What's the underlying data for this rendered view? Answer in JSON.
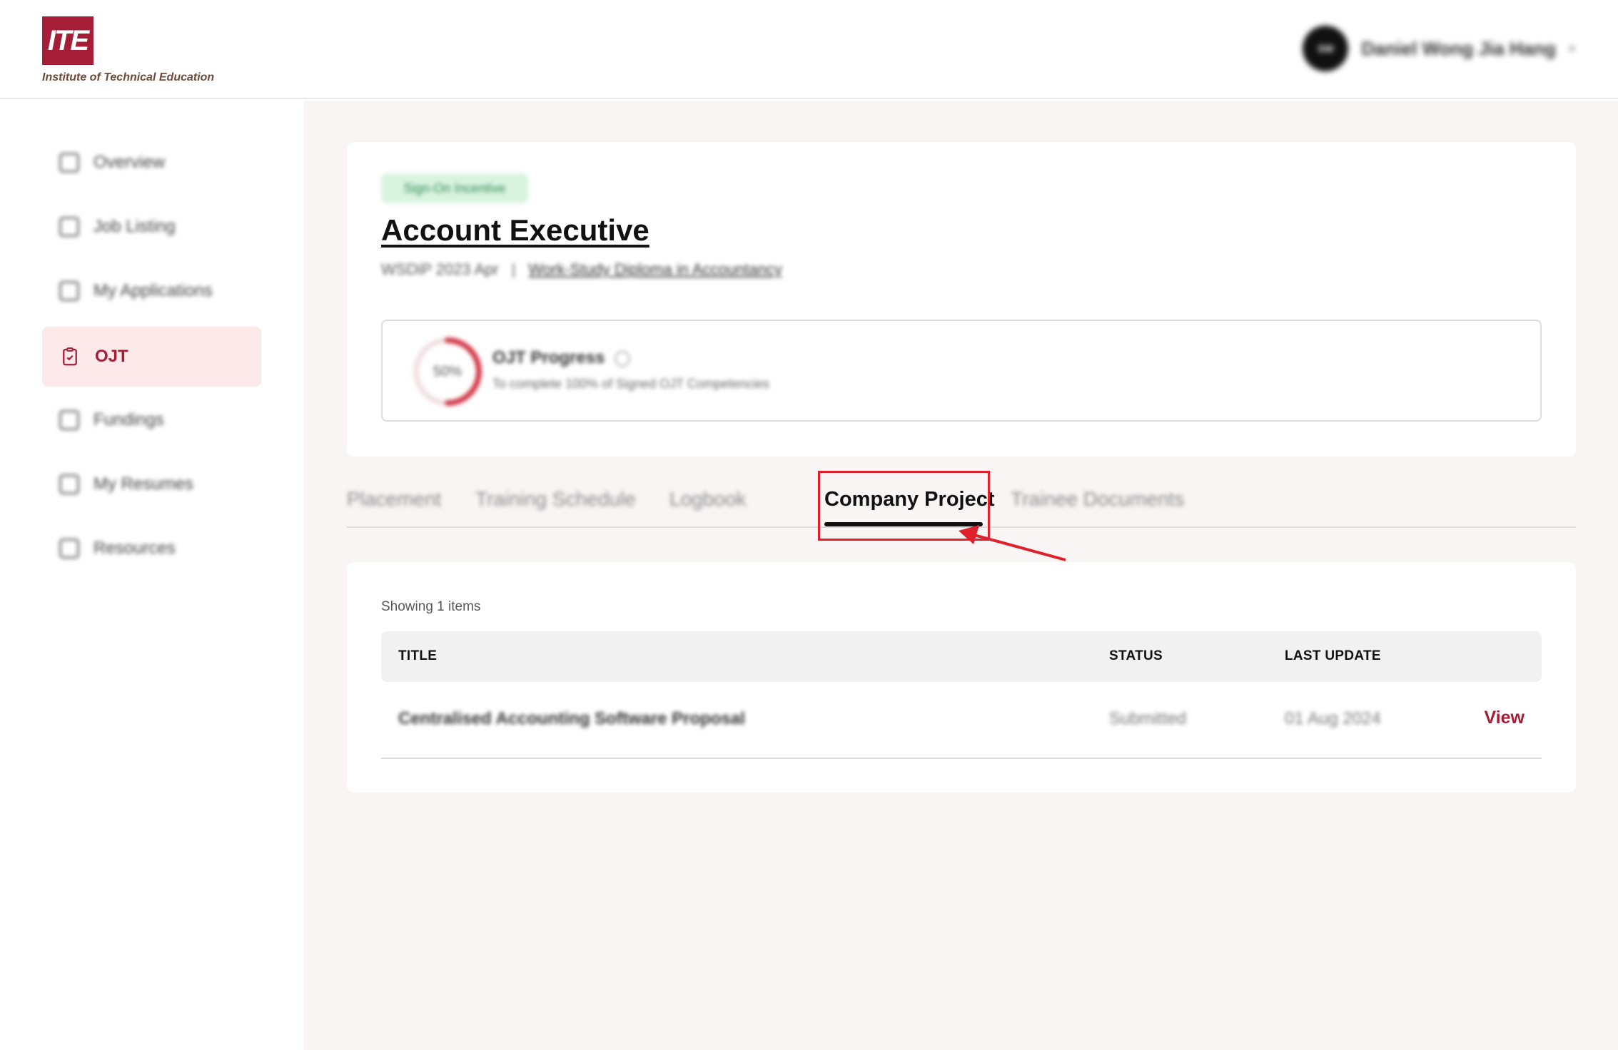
{
  "header": {
    "logo_mark": "ITE",
    "logo_text": "Institute of Technical Education",
    "user": {
      "initials": "SW",
      "name": "Daniel Wong Jia Hang"
    }
  },
  "sidebar": {
    "items": [
      {
        "label": "Overview",
        "icon": "dashboard-icon",
        "active": false
      },
      {
        "label": "Job Listing",
        "icon": "briefcase-icon",
        "active": false
      },
      {
        "label": "My Applications",
        "icon": "document-icon",
        "active": false
      },
      {
        "label": "OJT",
        "icon": "clipboard-check-icon",
        "active": true
      },
      {
        "label": "Fundings",
        "icon": "money-icon",
        "active": false
      },
      {
        "label": "My Resumes",
        "icon": "resume-icon",
        "active": false
      },
      {
        "label": "Resources",
        "icon": "folder-icon",
        "active": false
      }
    ]
  },
  "job": {
    "status_tag": "Sign-On Incentive",
    "title": "Account Executive",
    "intake": "WSDiP 2023 Apr",
    "separator": "|",
    "course": "Work-Study Diploma in Accountancy"
  },
  "progress": {
    "percent_label": "50%",
    "percent_value": 50,
    "title": "OJT Progress",
    "description": "To complete 100% of Signed OJT Competencies",
    "accent_color": "#d23a4a"
  },
  "tabs": [
    {
      "label": "Placement",
      "active": false
    },
    {
      "label": "Training Schedule",
      "active": false
    },
    {
      "label": "Logbook",
      "active": false
    },
    {
      "label": "Company Project",
      "active": true
    },
    {
      "label": "Trainee Documents",
      "active": false
    }
  ],
  "table": {
    "showing": "Showing 1 items",
    "columns": [
      "TITLE",
      "STATUS",
      "LAST UPDATE"
    ],
    "rows": [
      {
        "title": "Centralised Accounting Software Proposal",
        "status": "Submitted",
        "last_update": "01 Aug 2024",
        "action": "View"
      }
    ]
  },
  "colors": {
    "brand": "#a51d36",
    "annotation": "#e0202a"
  }
}
